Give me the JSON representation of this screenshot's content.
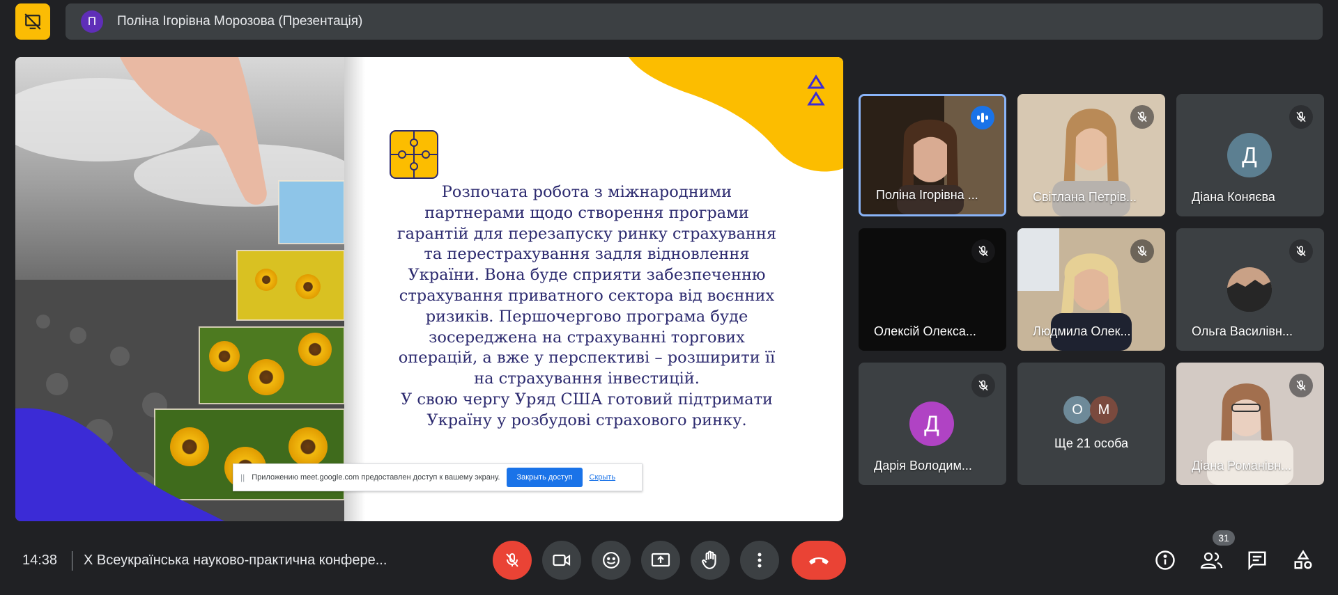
{
  "presenter": {
    "avatar_letter": "П",
    "label": "Поліна Ігорівна Морозова (Презентація)"
  },
  "slide": {
    "text": "Розпочата робота з міжнародними\nпартнерами щодо створення програми\nгарантій для перезапуску ринку страхування\nта перестрахування задля відновлення\nУкраїни. Вона буде сприяти забезпеченню\nстрахування приватного сектора від воєнних\nризиків. Першочергово програма буде\nзосереджена на страхуванні торгових\nоперацій, а вже у перспективі – розширити її\nна страхування інвестицій.\nУ свою чергу Уряд США готовий підтримати\nУкраїну у розбудові страхового ринку.",
    "accent_colors": {
      "navy": "#2c2a6f",
      "yellow": "#fcbd00",
      "purple": "#3b2bd6"
    }
  },
  "share_notice": {
    "text": "Приложению meet.google.com предоставлен доступ к вашему экрану.",
    "stop_label": "Закрыть доступ",
    "hide_label": "Скрыть"
  },
  "participants": [
    {
      "name": "Поліна Ігорівна ...",
      "kind": "video",
      "status": "speaking"
    },
    {
      "name": "Світлана Петрів...",
      "kind": "video",
      "status": "muted"
    },
    {
      "name": "Діана Коняєва",
      "kind": "avatar",
      "letter": "Д",
      "color": "#5c7f91",
      "status": "muted"
    },
    {
      "name": "Олексій Олекса...",
      "kind": "black",
      "status": "muted"
    },
    {
      "name": "Людмила Олек...",
      "kind": "video",
      "status": "muted"
    },
    {
      "name": "Ольга Василівн...",
      "kind": "photo-avatar",
      "status": "muted"
    },
    {
      "name": "Дарія Володим...",
      "kind": "avatar",
      "letter": "Д",
      "color": "#b043c4",
      "status": "muted"
    },
    {
      "name": "Ще 21 особа",
      "kind": "overflow",
      "letters": [
        "О",
        "М"
      ],
      "colors": [
        "#6e8a99",
        "#7a4a3e"
      ]
    },
    {
      "name": "Діана Романівн...",
      "kind": "video",
      "status": "muted"
    }
  ],
  "bottom_bar": {
    "time": "14:38",
    "meeting_title": "X Всеукраїнська науково-практична конфере...",
    "participant_count": "31"
  }
}
